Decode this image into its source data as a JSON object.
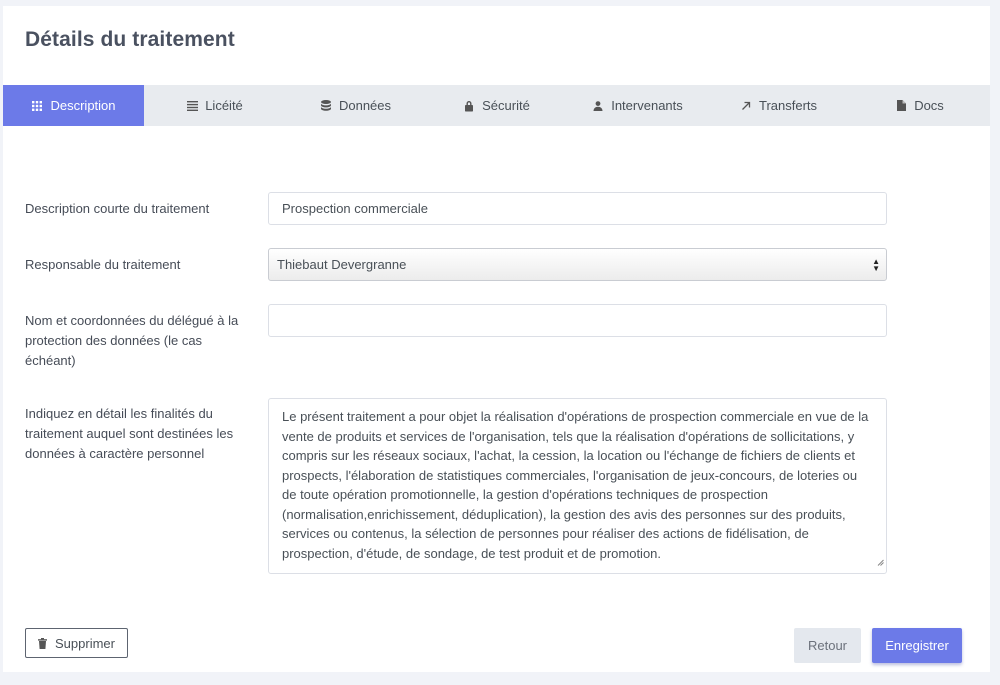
{
  "page": {
    "title": "Détails du traitement"
  },
  "tabs": [
    {
      "label": "Description",
      "icon": "grid-icon",
      "active": true
    },
    {
      "label": "Licéité",
      "icon": "list-icon",
      "active": false
    },
    {
      "label": "Données",
      "icon": "database-icon",
      "active": false
    },
    {
      "label": "Sécurité",
      "icon": "lock-icon",
      "active": false
    },
    {
      "label": "Intervenants",
      "icon": "user-icon",
      "active": false
    },
    {
      "label": "Transferts",
      "icon": "arrow-up-right-icon",
      "active": false
    },
    {
      "label": "Docs",
      "icon": "document-icon",
      "active": false
    }
  ],
  "form": {
    "short_description": {
      "label": "Description courte du traitement",
      "value": "Prospection commerciale"
    },
    "controller": {
      "label": "Responsable du traitement",
      "value": "Thiebaut Devergranne"
    },
    "dpo": {
      "label": "Nom et coordonnées du délégué à la protection des données (le cas échéant)",
      "value": ""
    },
    "purposes": {
      "label": "Indiquez en détail les finalités du traitement auquel sont destinées les données à caractère personnel",
      "value": "Le présent traitement a pour objet la réalisation d'opérations de prospection commerciale en vue de la vente de produits et services de l'organisation, tels que la réalisation d'opérations de sollicitations, y compris sur les réseaux sociaux, l'achat, la cession, la location ou l'échange de fichiers de clients et prospects, l'élaboration de statistiques commerciales, l'organisation de jeux-concours, de loteries ou de toute opération promotionnelle, la gestion d'opérations techniques de prospection (normalisation,enrichissement, déduplication), la gestion des avis des personnes sur des produits, services ou contenus, la sélection de personnes pour réaliser des actions de fidélisation, de prospection, d'étude, de sondage, de test produit et de promotion."
    }
  },
  "actions": {
    "delete_label": "Supprimer",
    "back_label": "Retour",
    "save_label": "Enregistrer"
  },
  "colors": {
    "accent": "#6c7ae8",
    "tab_bar": "#e8ebef",
    "page_bg": "#f1f3f8"
  }
}
